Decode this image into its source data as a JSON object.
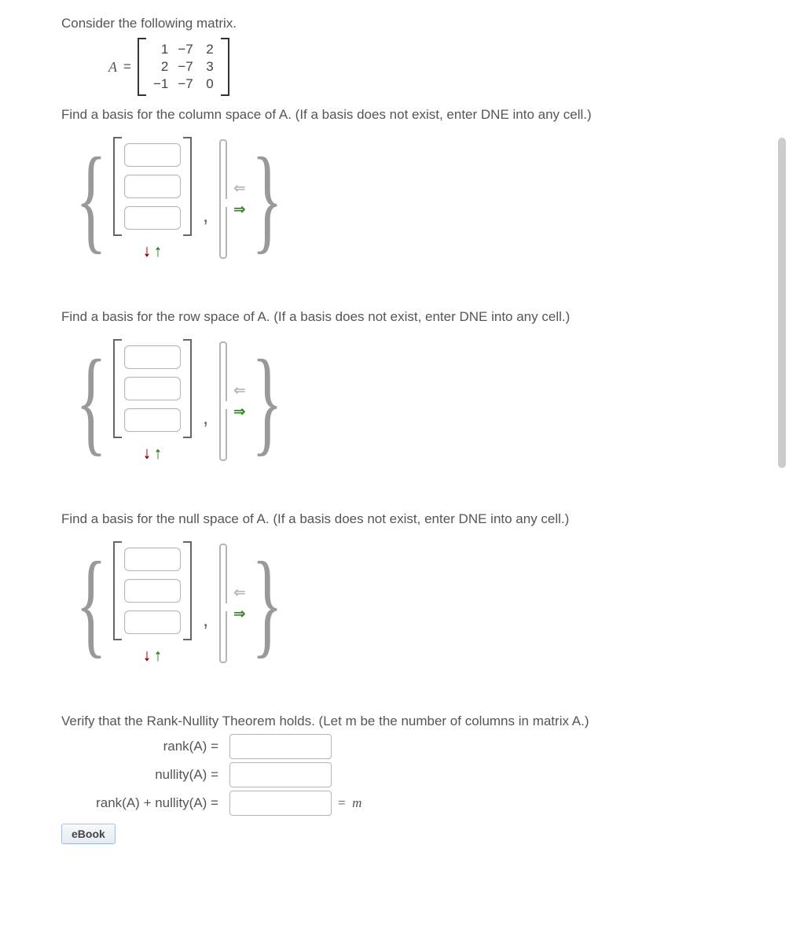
{
  "intro": "Consider the following matrix.",
  "matrixVar": "A",
  "matrixEq": "=",
  "matrix": [
    [
      "1",
      "−7",
      "2"
    ],
    [
      "2",
      "−7",
      "3"
    ],
    [
      "−1",
      "−7",
      "0"
    ]
  ],
  "q_colspace": "Find a basis for the column space of A. (If a basis does not exist, enter DNE into any cell.)",
  "q_rowspace": "Find a basis for the row space of A. (If a basis does not exist, enter DNE into any cell.)",
  "q_nullspace": "Find a basis for the null space of A. (If a basis does not exist, enter DNE into any cell.)",
  "q_verify": "Verify that the Rank-Nullity Theorem holds. (Let m be the number of columns in matrix A.)",
  "rank_rows": {
    "r1": "rank(A)  =",
    "r2": "nullity(A)  =",
    "r3": "rank(A) + nullity(A)  =",
    "m_suffix": "=  m"
  },
  "inputs": {
    "colspace_vec": [
      "",
      "",
      ""
    ],
    "rowspace_vec": [
      "",
      "",
      ""
    ],
    "nullspace_vec": [
      "",
      "",
      ""
    ],
    "rank": "",
    "nullity": "",
    "sum": ""
  },
  "icons": {
    "down": "↓",
    "up": "↑",
    "left": "⇐",
    "right": "⇒"
  },
  "ebook_label": "eBook",
  "comma": ","
}
